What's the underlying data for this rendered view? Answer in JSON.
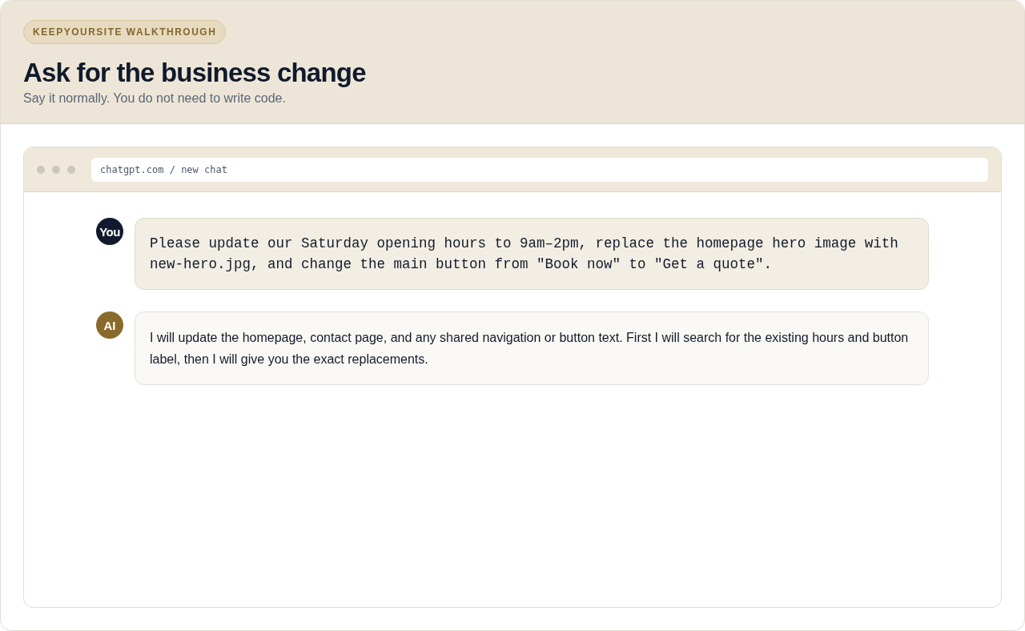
{
  "header": {
    "badge": "KEEPYOURSITE WALKTHROUGH",
    "title": "Ask for the business change",
    "subtitle": "Say it normally. You do not need to write code."
  },
  "browser": {
    "address": "chatgpt.com / new chat"
  },
  "messages": [
    {
      "kind": "user",
      "avatar": "You",
      "text": "Please update our Saturday opening hours to 9am–2pm, replace the homepage hero image with new-hero.jpg, and change the main button from \"Book now\" to \"Get a quote\"."
    },
    {
      "kind": "assistant",
      "avatar": "AI",
      "text": "I will update the homepage, contact page, and any shared navigation or button text. First I will search for the existing hours and button label, then I will give you the exact replacements."
    }
  ]
}
